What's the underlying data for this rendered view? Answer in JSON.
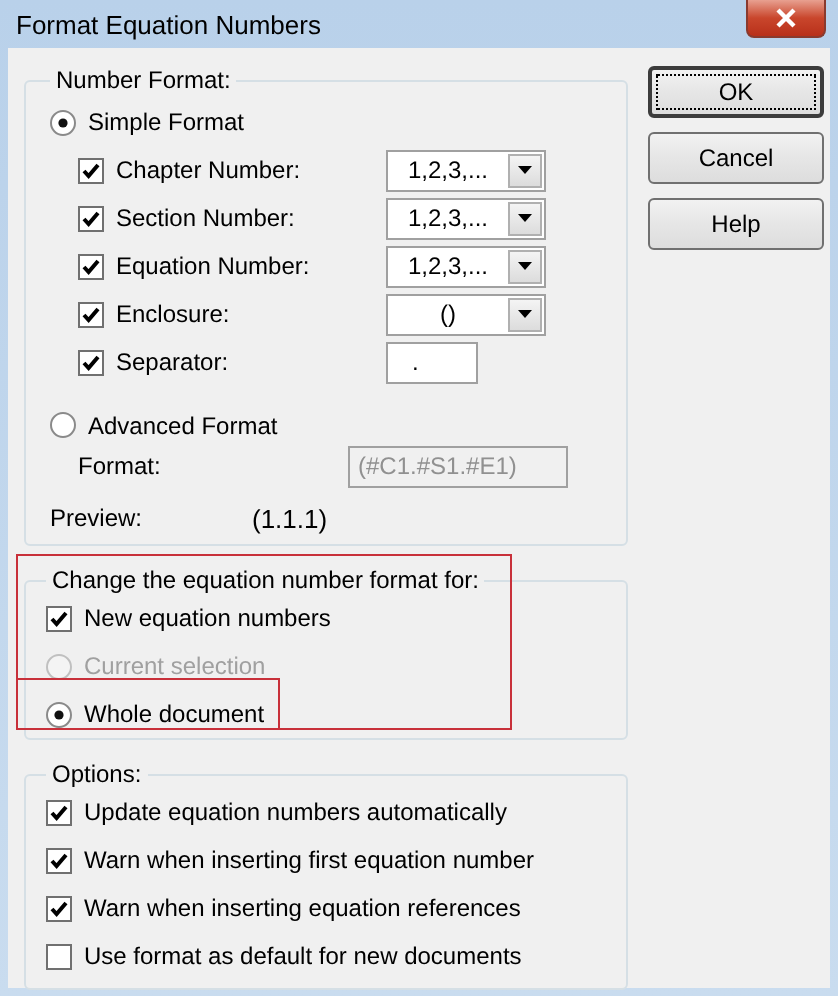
{
  "window": {
    "title": "Format Equation Numbers"
  },
  "number_format": {
    "legend": "Number Format:",
    "simple_format": {
      "label": "Simple Format",
      "selected": true
    },
    "fields": [
      {
        "kind": "dropdown",
        "label": "Chapter Number:",
        "checked": true,
        "value": "1,2,3,..."
      },
      {
        "kind": "dropdown",
        "label": "Section Number:",
        "checked": true,
        "value": "1,2,3,..."
      },
      {
        "kind": "dropdown",
        "label": "Equation Number:",
        "checked": true,
        "value": "1,2,3,..."
      },
      {
        "kind": "dropdown",
        "label": "Enclosure:",
        "checked": true,
        "value": "()"
      },
      {
        "kind": "text",
        "label": "Separator:",
        "checked": true,
        "value": "."
      }
    ],
    "advanced_format": {
      "label": "Advanced Format",
      "selected": false
    },
    "format": {
      "label": "Format:",
      "placeholder": "(#C1.#S1.#E1)",
      "disabled": true
    },
    "preview": {
      "label": "Preview:",
      "value": "(1.1.1)"
    }
  },
  "change_for": {
    "legend": "Change the equation number format for:",
    "new_equation_numbers": {
      "label": "New equation numbers",
      "checked": true
    },
    "scope": [
      {
        "label": "Current selection",
        "selected": false,
        "disabled": true
      },
      {
        "label": "Whole document",
        "selected": true,
        "disabled": false
      }
    ]
  },
  "options": {
    "legend": "Options:",
    "items": [
      {
        "label": "Update equation numbers automatically",
        "checked": true
      },
      {
        "label": "Warn when inserting first equation number",
        "checked": true
      },
      {
        "label": "Warn when inserting equation references",
        "checked": true
      },
      {
        "label": "Use format as default for new documents",
        "checked": false
      }
    ]
  },
  "buttons": [
    {
      "label": "OK",
      "default": true
    },
    {
      "label": "Cancel",
      "default": false
    },
    {
      "label": "Help",
      "default": false
    }
  ]
}
